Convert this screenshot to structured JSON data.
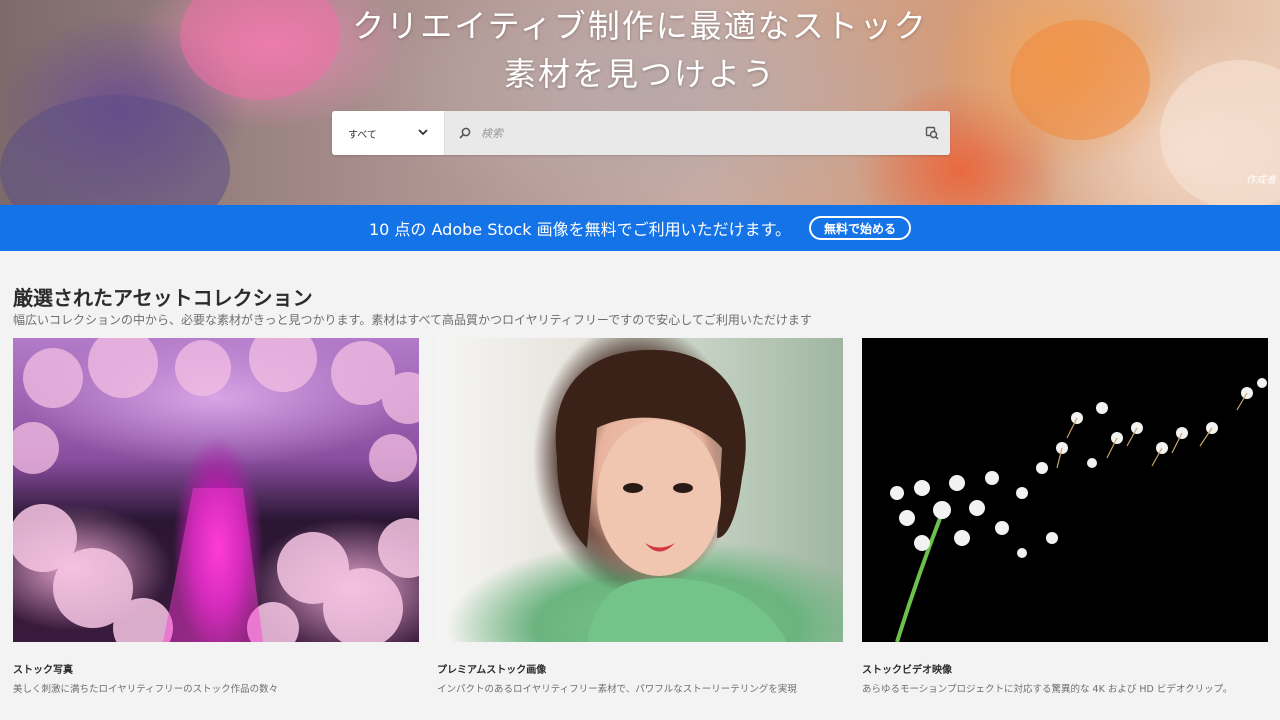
{
  "hero": {
    "title_line1": "クリエイティブ制作に最適なストック",
    "title_line2": "素材を見つけよう",
    "credit": "作成者"
  },
  "search": {
    "category": "すべて",
    "placeholder": "検索"
  },
  "banner": {
    "text": "10 点の Adobe Stock 画像を無料でご利用いただけます。",
    "cta": "無料で始める",
    "color": "#1473e6"
  },
  "section": {
    "title": "厳選されたアセットコレクション",
    "subtitle": "幅広いコレクションの中から、必要な素材がきっと見つかります。素材はすべて高品質かつロイヤリティフリーですので安心してご利用いただけます"
  },
  "cards": [
    {
      "title": "ストック写真",
      "desc": "美しく刺激に満ちたロイヤリティフリーのストック作品の数々"
    },
    {
      "title": "プレミアムストック画像",
      "desc": "インパクトのあるロイヤリティフリー素材で、パワフルなストーリーテリングを実現"
    },
    {
      "title": "ストックビデオ映像",
      "desc": "あらゆるモーションプロジェクトに対応する驚異的な 4K および HD ビデオクリップ。"
    }
  ]
}
